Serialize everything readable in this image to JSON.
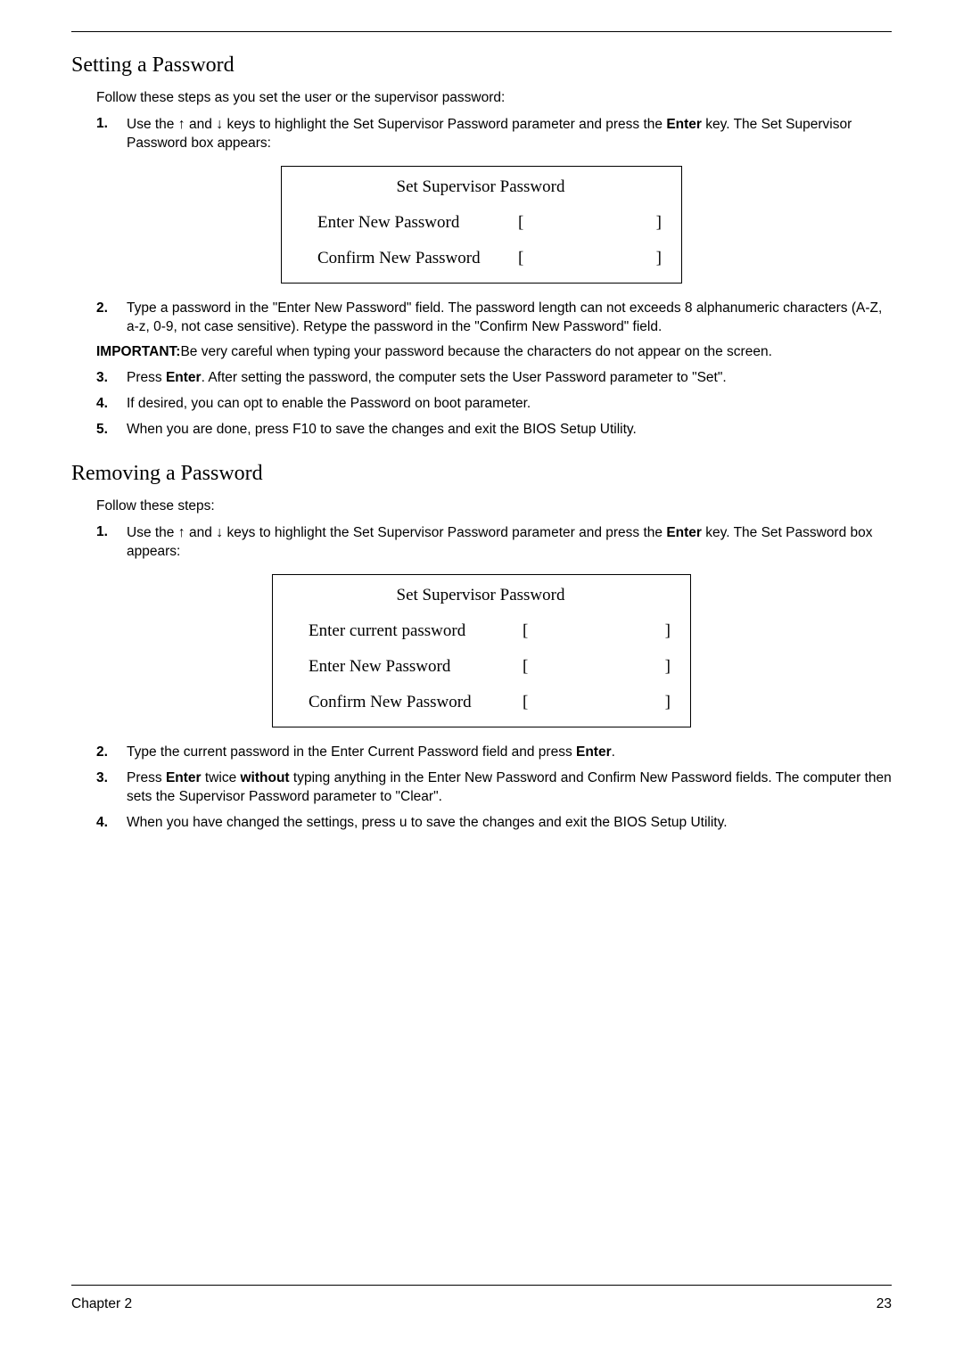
{
  "section1": {
    "heading": "Setting a Password",
    "intro": "Follow these steps as you set the user or the supervisor password:",
    "step1": {
      "num": "1.",
      "pre": "Use the ",
      "up": "↑",
      "mid1": " and ",
      "down": "↓",
      "mid2": " keys to highlight the Set Supervisor Password parameter and press the ",
      "enter": "Enter",
      "post": " key. The Set Supervisor Password box appears:"
    },
    "dialog1": {
      "title": "Set Supervisor Password",
      "row1": "Enter New Password",
      "row2": "Confirm New Password",
      "brkl": "[",
      "brkr": "]"
    },
    "step2": {
      "num": "2.",
      "text": "Type a password in the \"Enter New Password\" field. The password length can not exceeds 8 alphanumeric characters (A-Z, a-z, 0-9, not case sensitive). Retype the password in the \"Confirm New Password\" field."
    },
    "important": {
      "label": "IMPORTANT:",
      "text": "Be very careful when typing your password because the characters do not appear on the screen."
    },
    "step3": {
      "num": "3.",
      "pre": "Press ",
      "enter": "Enter",
      "post": ". After setting the password, the computer sets the User Password parameter to \"Set\"."
    },
    "step4": {
      "num": "4.",
      "text": "If desired, you can opt to enable the Password on boot parameter."
    },
    "step5": {
      "num": "5.",
      "text": "When you are done, press F10 to save the changes and exit the BIOS Setup Utility."
    }
  },
  "section2": {
    "heading": "Removing a Password",
    "intro": "Follow these steps:",
    "step1": {
      "num": "1.",
      "pre": "Use the ",
      "up": "↑",
      "mid1": " and ",
      "down": "↓",
      "mid2": " keys to highlight the Set Supervisor Password parameter and press the ",
      "enter": "Enter",
      "post": " key. The Set Password box appears:"
    },
    "dialog2": {
      "title": "Set Supervisor Password",
      "row1": "Enter current password",
      "row2": "Enter New Password",
      "row3": "Confirm New Password",
      "brkl": "[",
      "brkr": "]"
    },
    "step2": {
      "num": "2.",
      "pre": "Type the current password in the Enter Current Password field and press ",
      "enter": "Enter",
      "post": "."
    },
    "step3": {
      "num": "3.",
      "pre": "Press ",
      "enter": "Enter",
      "mid1": " twice ",
      "without": "without",
      "post": " typing anything in the Enter New Password and Confirm New Password fields. The computer then sets the Supervisor Password parameter to \"Clear\"."
    },
    "step4": {
      "num": "4.",
      "text": "When you have changed the settings, press u to save the changes and exit the BIOS Setup Utility."
    }
  },
  "footer": {
    "left": "Chapter 2",
    "right": "23"
  }
}
